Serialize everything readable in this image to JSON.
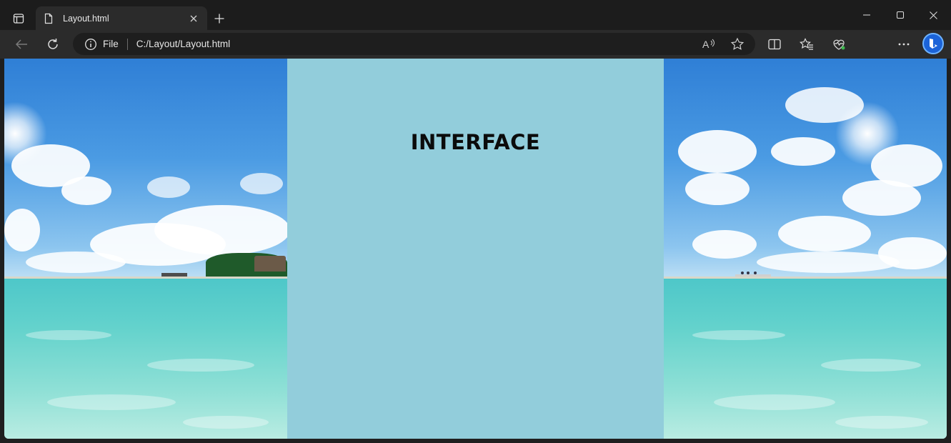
{
  "browser": {
    "tab": {
      "title": "Layout.html"
    },
    "address": {
      "scheme": "File",
      "url": "C:/Layout/Layout.html"
    },
    "icons": [
      "tab-actions-icon",
      "page-icon",
      "close-tab-icon",
      "new-tab-icon",
      "minimize-icon",
      "maximize-icon",
      "close-window-icon",
      "back-icon",
      "refresh-icon",
      "info-icon",
      "read-aloud-icon",
      "favorite-star-icon",
      "split-screen-icon",
      "favorites-icon",
      "browser-essentials-icon",
      "more-icon",
      "bing-copilot-icon"
    ]
  },
  "page": {
    "heading": "INTERFACE",
    "background_color": "#92cddb",
    "images": [
      "tropical-beach-panorama-left",
      "tropical-beach-panorama-right"
    ]
  }
}
